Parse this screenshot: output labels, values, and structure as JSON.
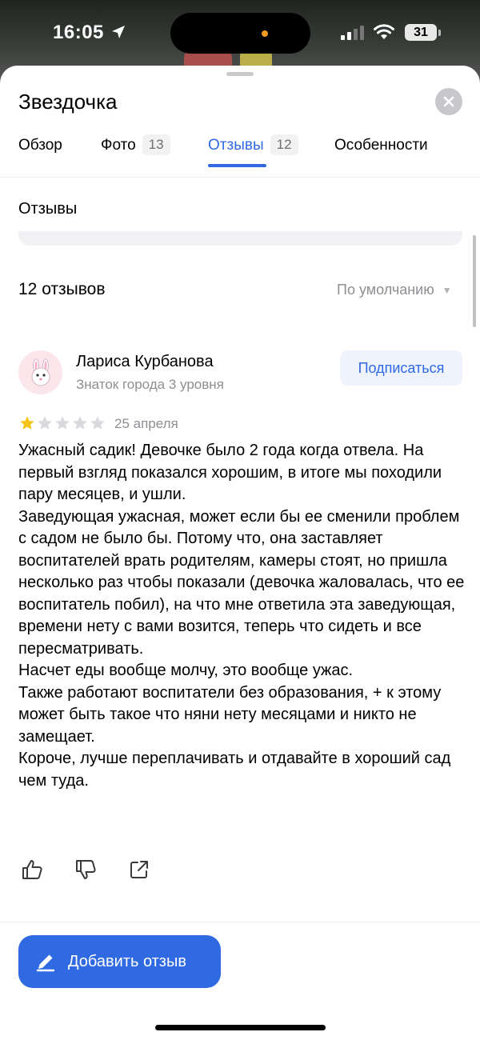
{
  "status_bar": {
    "time": "16:05",
    "battery": "31"
  },
  "header": {
    "title": "Звездочка"
  },
  "tabs": [
    {
      "label": "Обзор",
      "count": ""
    },
    {
      "label": "Фото",
      "count": "13"
    },
    {
      "label": "Отзывы",
      "count": "12",
      "active": true
    },
    {
      "label": "Особенности",
      "count": ""
    }
  ],
  "section": {
    "heading": "Отзывы"
  },
  "reviews_header": {
    "count_label": "12 отзывов",
    "sort_label": "По умолчанию"
  },
  "review": {
    "author": "Лариса Курбанова",
    "level": "Знаток города 3 уровня",
    "subscribe_label": "Подписаться",
    "rating": 1,
    "rating_max": 5,
    "date": "25 апреля",
    "text": "Ужасный садик! Девочке было 2 года когда отвела. На первый взгляд показался хорошим, в итоге мы походили пару месяцев, и ушли.\nЗаведующая ужасная, может если бы ее сменили проблем с садом не было бы. Потому что, она заставляет воспитателей врать родителям, камеры стоят, но пришла несколько раз чтобы показали (девочка жаловалась, что ее воспитатель побил), на что мне ответила эта заведующая, времени нету с вами возится, теперь что сидеть и все пересматривать.\nНасчет еды вообще молчу, это вообще ужас.\nТакже работают воспитатели без образования, + к этому может быть такое что няни нету месяцами и никто не замещает.\nКороче, лучше переплачивать и отдавайте в хороший сад чем туда."
  },
  "footer": {
    "add_review_label": "Добавить отзыв"
  },
  "colors": {
    "accent": "#2f6ae3",
    "star_filled": "#f5c518",
    "star_empty": "#d9d9de"
  }
}
